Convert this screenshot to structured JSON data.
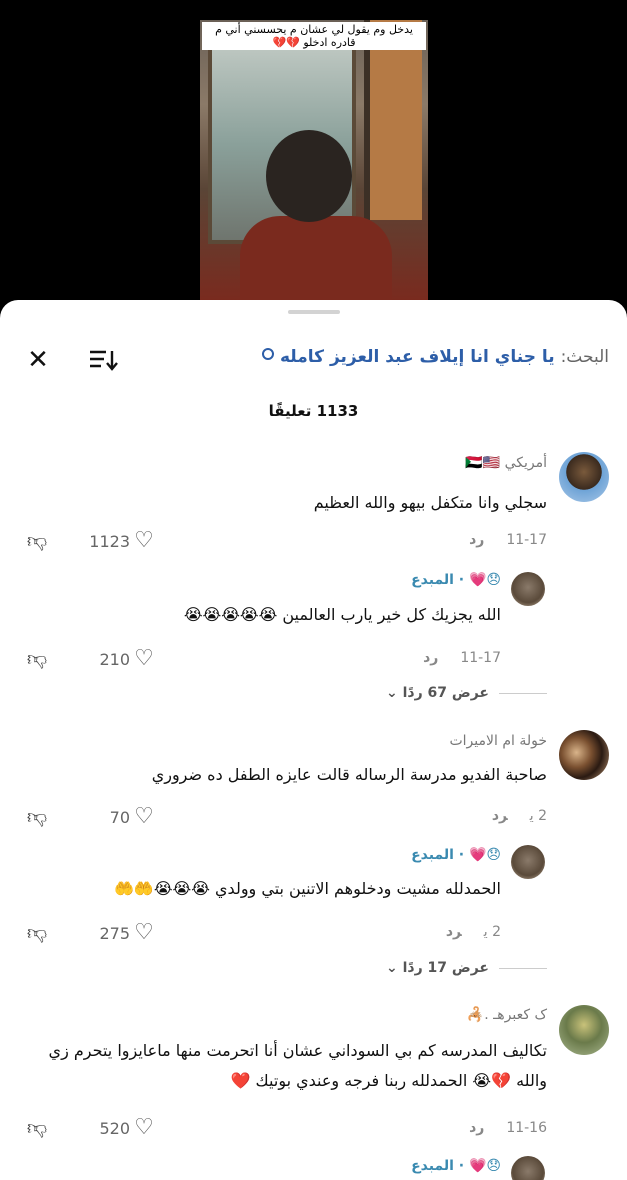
{
  "video": {
    "caption": "يدخل وم يقول لي عشان م يحسسني أني م قادره ادخلو 💔💔"
  },
  "header": {
    "search_label": "البحث:",
    "search_query": "يا جناي انا إيلاف عبد العزيز كامله",
    "comment_count": "1133 تعليقًا"
  },
  "comments": [
    {
      "name": "أمريكي 🇸🇩🇺🇸",
      "text": "سجلي وانا متكفل بيهو والله العظيم",
      "date": "11-17",
      "reply": "رد",
      "likes": "1123"
    },
    {
      "name": "😞💗 · المبدع",
      "text": "الله يجزيك كل خير يارب العالمين 😭😭😭😭😭",
      "date": "11-17",
      "reply": "رد",
      "likes": "210",
      "view_more": "عرض 67 ردًا"
    },
    {
      "name": "خولة ام الاميرات",
      "text": "صاحبة الفديو مدرسة الرساله قالت عايزه الطفل ده ضروري",
      "date": "2 ي",
      "reply": "رد",
      "likes": "70"
    },
    {
      "name": "😞💗 · المبدع",
      "text": "الحمدلله مشيت ودخلوهم الاتنين بتي وولدي 😭😭😭🤲🤲",
      "date": "2 ي",
      "reply": "رد",
      "likes": "275",
      "view_more": "عرض 17 ردًا"
    },
    {
      "name": "ک کعبرهـ .🦂",
      "text": "تكاليف المدرسه كم بي السوداني عشان أنا اتحرمت منها ماعايزوا يتحرم زي والله 💔😭 الحمدلله ربنا فرجه وعندي بوتيك ❤️",
      "date": "11-16",
      "reply": "رد",
      "likes": "520"
    },
    {
      "name": "😞💗 · المبدع"
    }
  ]
}
